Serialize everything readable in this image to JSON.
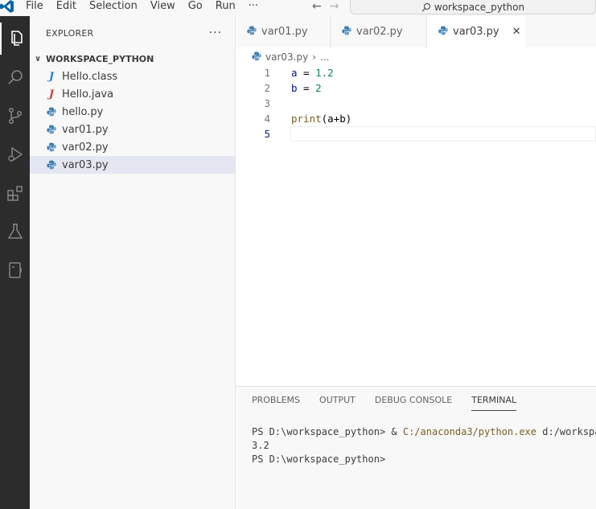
{
  "menu": {
    "items": [
      "File",
      "Edit",
      "Selection",
      "View",
      "Go",
      "Run",
      "···"
    ]
  },
  "command_center": {
    "label": "workspace_python",
    "icon": "search-icon"
  },
  "activity_bar": {
    "icons": [
      "explorer-icon",
      "search-icon",
      "source-control-icon",
      "run-debug-icon",
      "extensions-icon",
      "testing-icon",
      "remote-explorer-icon"
    ]
  },
  "sidebar": {
    "title": "EXPLORER",
    "more": "···",
    "folder": "WORKSPACE_PYTHON",
    "files": [
      {
        "name": "Hello.class",
        "icon": "java-class-icon"
      },
      {
        "name": "Hello.java",
        "icon": "java-icon"
      },
      {
        "name": "hello.py",
        "icon": "python-icon"
      },
      {
        "name": "var01.py",
        "icon": "python-icon"
      },
      {
        "name": "var02.py",
        "icon": "python-icon"
      },
      {
        "name": "var03.py",
        "icon": "python-icon",
        "selected": true
      }
    ]
  },
  "tabs": [
    {
      "label": "var01.py"
    },
    {
      "label": "var02.py"
    },
    {
      "label": "var03.py",
      "active": true,
      "close": "✕"
    }
  ],
  "breadcrumb": {
    "file": "var03.py",
    "sep": "›",
    "rest": "..."
  },
  "editor": {
    "line_numbers": [
      "1",
      "2",
      "3",
      "4",
      "5"
    ],
    "lines": [
      {
        "var": "a",
        "op": " = ",
        "num": "1.2"
      },
      {
        "var": "b",
        "op": " = ",
        "num": "2"
      },
      {
        "text": ""
      },
      {
        "fn": "print",
        "args": "(a+b)"
      },
      {
        "text": ""
      }
    ],
    "current_line": 5
  },
  "panel": {
    "tabs": [
      "PROBLEMS",
      "OUTPUT",
      "DEBUG CONSOLE",
      "TERMINAL"
    ],
    "active_tab": "TERMINAL",
    "terminal": {
      "line1_prompt": "PS D:\\workspace_python> & ",
      "line1_exe": "C:/anaconda3/python.exe",
      "line1_rest": " d:/workspac",
      "line2": "3.2",
      "line3": "PS D:\\workspace_python>"
    }
  },
  "colors": {
    "accent": "#005fb8",
    "activity_bar": "#2c2c2c",
    "selected_row": "#e4e6f1",
    "python_icon": "#3e7fb3"
  }
}
